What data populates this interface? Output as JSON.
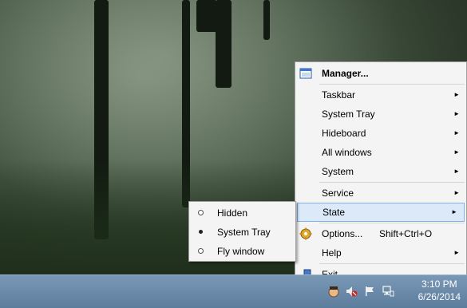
{
  "main_menu": {
    "items": [
      {
        "label": "Manager...",
        "icon": "window-manager-icon",
        "bold": true
      },
      {
        "label": "Taskbar",
        "submenu": true
      },
      {
        "label": "System Tray",
        "submenu": true
      },
      {
        "label": "Hideboard",
        "submenu": true
      },
      {
        "label": "All windows",
        "submenu": true
      },
      {
        "label": "System",
        "submenu": true
      },
      {
        "label": "Service",
        "submenu": true
      },
      {
        "label": "State",
        "submenu": true,
        "highlighted": true
      },
      {
        "label": "Options...",
        "icon": "gear-icon",
        "shortcut": "Shift+Ctrl+O"
      },
      {
        "label": "Help",
        "submenu": true
      },
      {
        "label": "Exit",
        "icon": "exit-icon"
      }
    ],
    "submenu_arrow": "►"
  },
  "state_submenu": {
    "items": [
      {
        "label": "Hidden",
        "selected": false
      },
      {
        "label": "System Tray",
        "selected": true
      },
      {
        "label": "Fly window",
        "selected": false
      }
    ]
  },
  "taskbar": {
    "time": "3:10 PM",
    "date": "6/26/2014",
    "tray_icons": [
      "app-tray-icon",
      "mute-icon",
      "flag-icon",
      "network-icon"
    ]
  },
  "colors": {
    "menu_bg": "#f4f4f4",
    "highlight_bg": "#dbe9f9",
    "highlight_border": "#7eb4ea",
    "taskbar": "#6b8aaa"
  }
}
